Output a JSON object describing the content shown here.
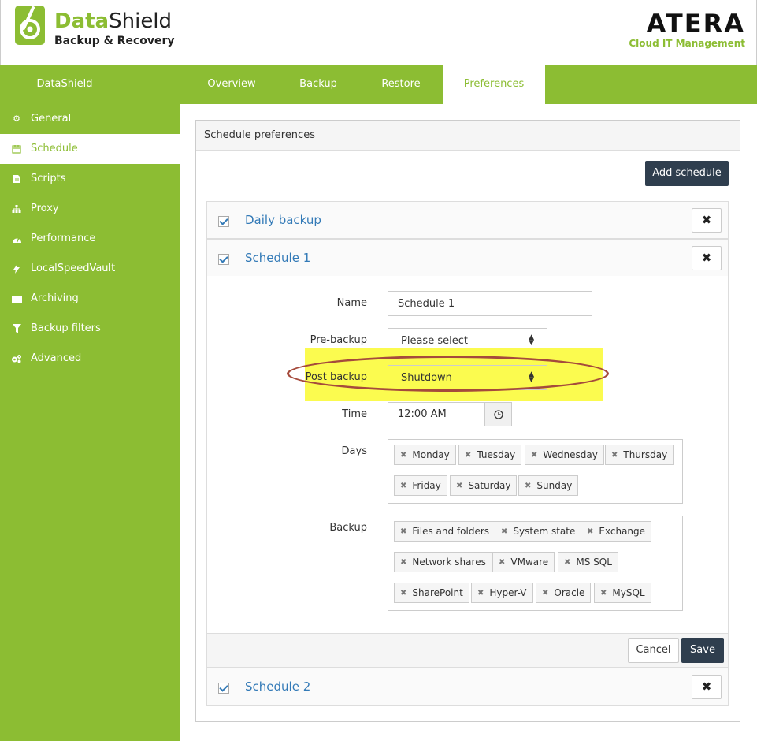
{
  "header": {
    "brand_a": "Data",
    "brand_b": "Shield",
    "brand_sub": "Backup & Recovery",
    "partner": "ATERA",
    "partner_sub": "Cloud IT Management"
  },
  "nav": {
    "home": "DataShield",
    "tabs": [
      {
        "label": "Overview"
      },
      {
        "label": "Backup"
      },
      {
        "label": "Restore"
      },
      {
        "label": "Preferences",
        "active": true
      }
    ]
  },
  "sidebar": {
    "items": [
      {
        "label": "General",
        "icon": "gear-icon"
      },
      {
        "label": "Schedule",
        "icon": "calendar-icon",
        "active": true
      },
      {
        "label": "Scripts",
        "icon": "document-icon"
      },
      {
        "label": "Proxy",
        "icon": "sitemap-icon"
      },
      {
        "label": "Performance",
        "icon": "gauge-icon"
      },
      {
        "label": "LocalSpeedVault",
        "icon": "bolt-icon"
      },
      {
        "label": "Archiving",
        "icon": "folder-icon"
      },
      {
        "label": "Backup filters",
        "icon": "filter-icon"
      },
      {
        "label": "Advanced",
        "icon": "cogs-icon"
      }
    ]
  },
  "panel": {
    "title": "Schedule preferences",
    "add_button": "Add schedule"
  },
  "schedules": [
    {
      "name": "Daily backup",
      "checked": true
    },
    {
      "name": "Schedule 1",
      "checked": true
    },
    {
      "name": "Schedule 2",
      "checked": true
    }
  ],
  "form": {
    "name_label": "Name",
    "name_value": "Schedule 1",
    "pre_label": "Pre-backup",
    "pre_value": "Please select",
    "post_label": "Post backup",
    "post_value": "Shutdown",
    "time_label": "Time",
    "time_value": "12:00 AM",
    "days_label": "Days",
    "days": [
      "Monday",
      "Tuesday",
      "Wednesday",
      "Thursday",
      "Friday",
      "Saturday",
      "Sunday"
    ],
    "backup_label": "Backup",
    "backup": [
      "Files and folders",
      "System state",
      "Exchange",
      "Network shares",
      "VMware",
      "MS SQL",
      "SharePoint",
      "Hyper-V",
      "Oracle",
      "MySQL"
    ],
    "cancel": "Cancel",
    "save": "Save"
  },
  "colors": {
    "brand_green": "#8cbd33",
    "dark_button": "#2f3e4e",
    "link_blue": "#337ab7",
    "highlight_yellow": "#fbfb4f",
    "annotation_red": "#a54a3c"
  }
}
